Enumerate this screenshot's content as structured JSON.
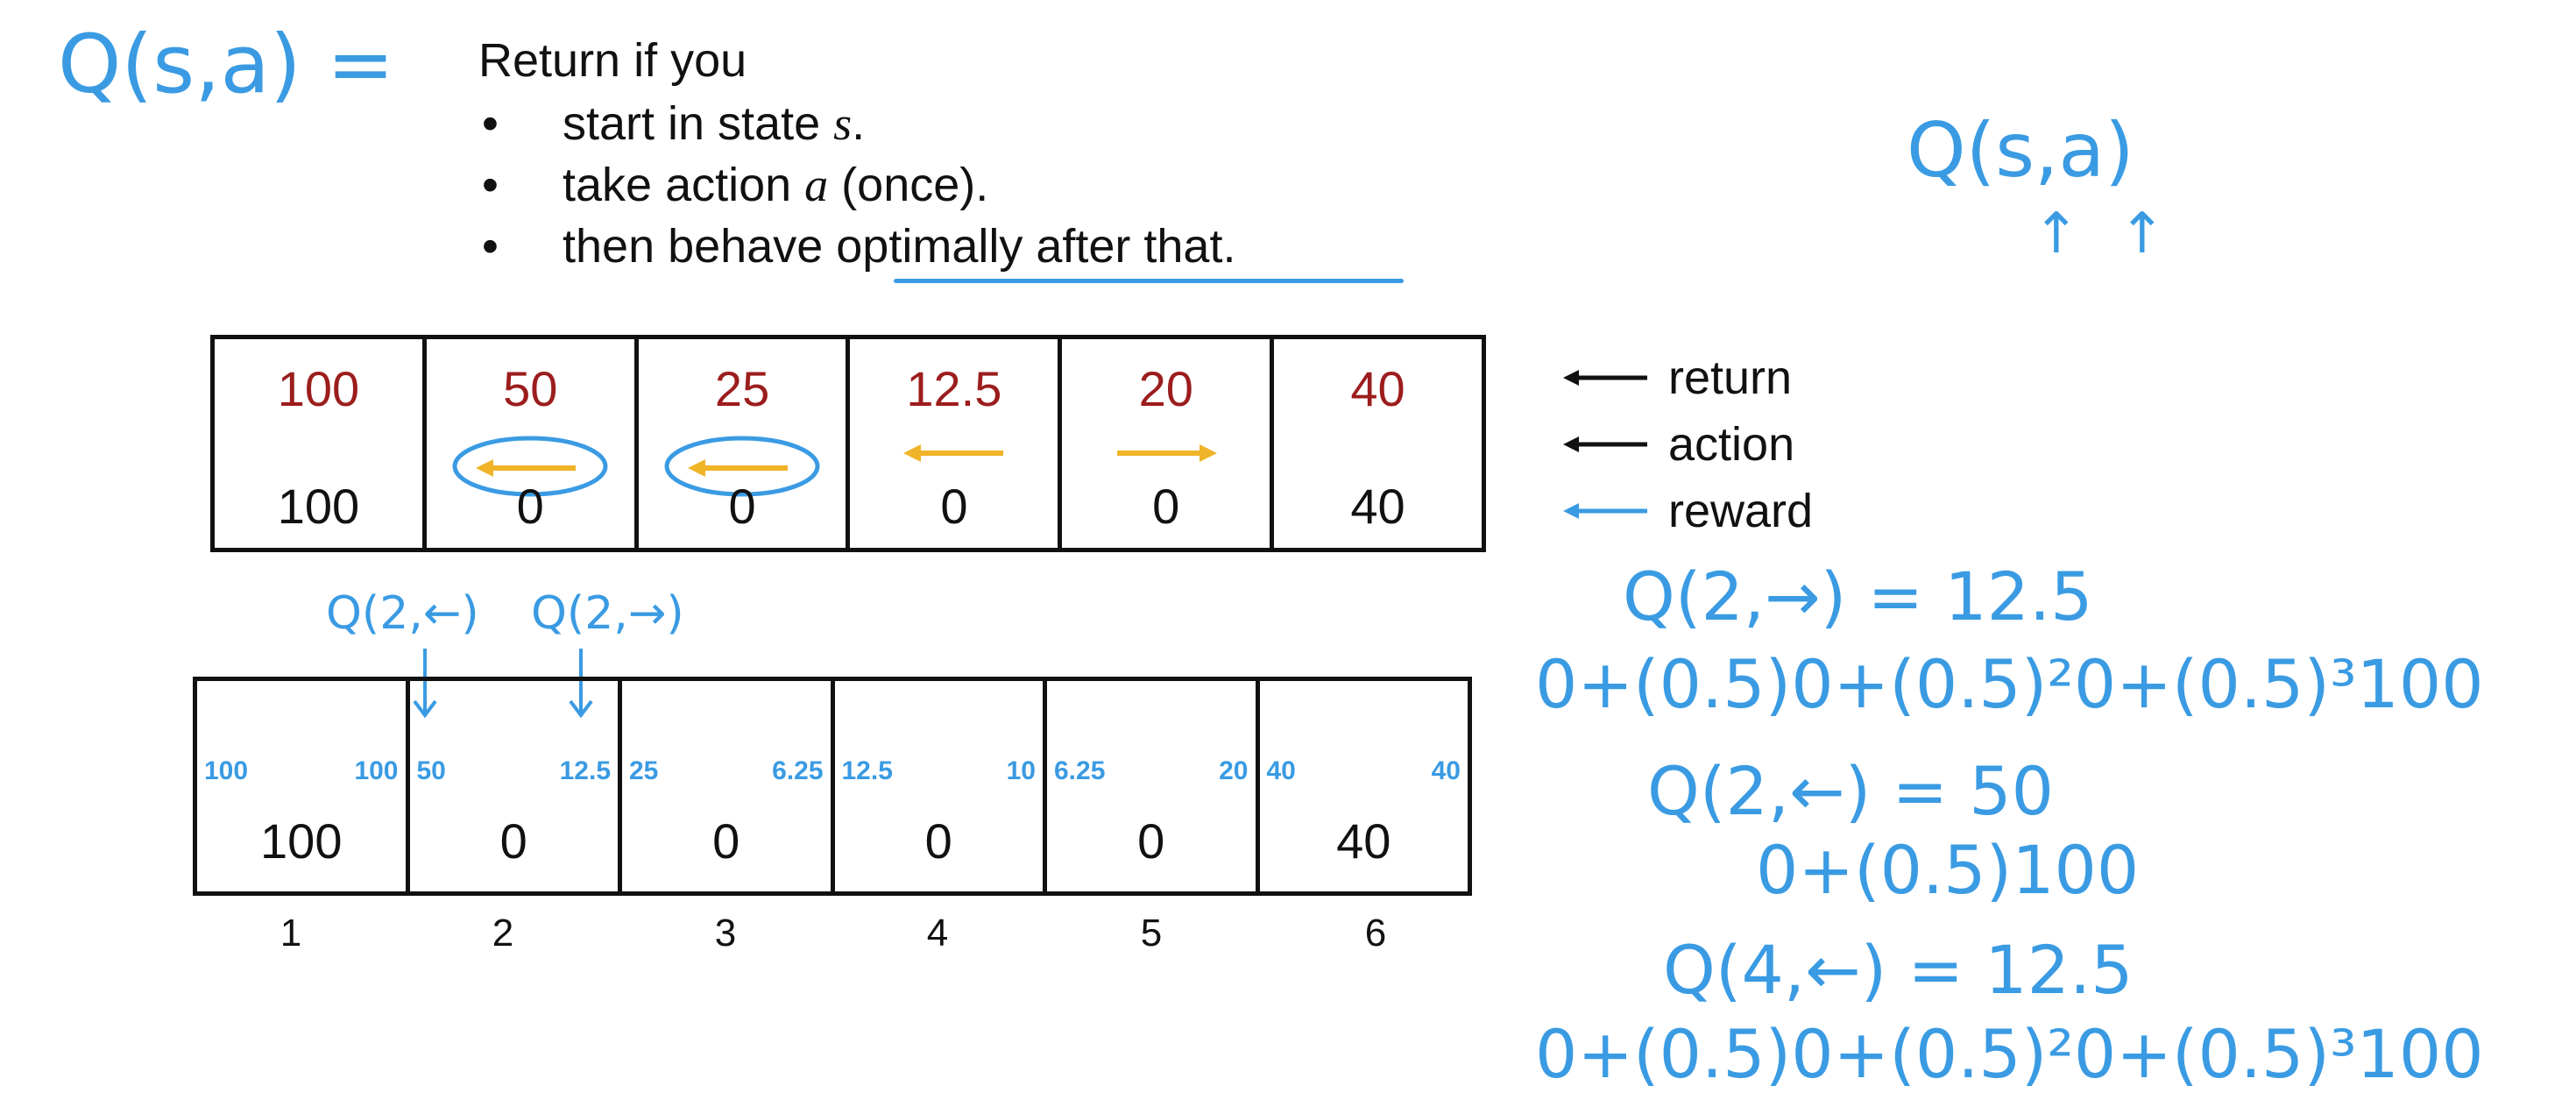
{
  "definition": {
    "lhs": "Q(s,a) =",
    "heading": "Return if you",
    "bullets": [
      {
        "pre": "start in state ",
        "var": "s",
        "post": "."
      },
      {
        "pre": "take action ",
        "var": "a",
        "post": " (once)."
      },
      {
        "pre": "then behave optimally after that.",
        "var": "",
        "post": ""
      }
    ]
  },
  "side_note": {
    "q": "Q(s,a)",
    "arrows": "↑ ↑"
  },
  "top_grid": {
    "returns": [
      "100",
      "50",
      "25",
      "12.5",
      "20",
      "40"
    ],
    "actions": [
      "none",
      "left",
      "left",
      "left",
      "right",
      "none"
    ],
    "circled": [
      false,
      true,
      true,
      false,
      false,
      false
    ],
    "rewards": [
      "100",
      "0",
      "0",
      "0",
      "0",
      "40"
    ]
  },
  "legend": {
    "return": "return",
    "action": "action",
    "reward": "reward"
  },
  "annotations": {
    "q_left": "Q(2,←)",
    "q_right": "Q(2,→)"
  },
  "bottom_grid": {
    "q_left": [
      "100",
      "50",
      "25",
      "12.5",
      "6.25",
      "40"
    ],
    "q_right": [
      "100",
      "12.5",
      "6.25",
      "10",
      "20",
      "40"
    ],
    "rewards": [
      "100",
      "0",
      "0",
      "0",
      "0",
      "40"
    ]
  },
  "state_numbers": [
    "1",
    "2",
    "3",
    "4",
    "5",
    "6"
  ],
  "equations": {
    "q2_right": "Q(2,→) = 12.5",
    "q2_right_calc": "0+(0.5)0+(0.5)²0+(0.5)³100",
    "q2_left": "Q(2,←) = 50",
    "q2_left_calc": "0+(0.5)100",
    "q4_left": "Q(4,←) = 12.5",
    "q4_left_calc": "0+(0.5)0+(0.5)²0+(0.5)³100"
  },
  "colors": {
    "handwriting": "#3a9be3",
    "return_red": "#9c1d1d",
    "action_yellow": "#f0b429"
  }
}
